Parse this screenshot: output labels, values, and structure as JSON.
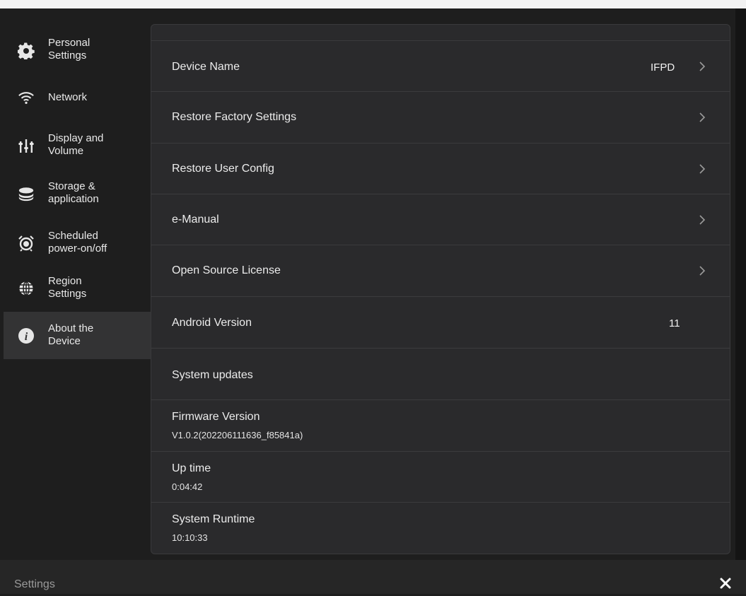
{
  "sidebar": {
    "items": [
      {
        "label": "Personal\nSettings",
        "icon": "gear-icon"
      },
      {
        "label": "Network",
        "icon": "wifi-icon"
      },
      {
        "label": "Display and\nVolume",
        "icon": "sliders-icon"
      },
      {
        "label": "Storage &\napplication",
        "icon": "storage-icon"
      },
      {
        "label": "Scheduled\npower-on/off",
        "icon": "alarm-clock-icon"
      },
      {
        "label": "Region\nSettings",
        "icon": "globe-icon"
      },
      {
        "label": "About the\nDevice",
        "icon": "info-icon",
        "active": true
      }
    ]
  },
  "main": {
    "rows": [
      {
        "label": "Device Name",
        "value": "IFPD",
        "chevron": true
      },
      {
        "label": "Restore Factory Settings",
        "chevron": true
      },
      {
        "label": "Restore User Config",
        "chevron": true
      },
      {
        "label": "e-Manual",
        "chevron": true
      },
      {
        "label": "Open Source License",
        "chevron": true
      },
      {
        "label": "Android Version",
        "value": "11"
      },
      {
        "label": "System updates"
      },
      {
        "label": "Firmware Version",
        "sub": "V1.0.2(202206111636_f85841a)"
      },
      {
        "label": "Up time",
        "sub": "0:04:42"
      },
      {
        "label": "System Runtime",
        "sub": "10:10:33"
      }
    ]
  },
  "footer": {
    "title": "Settings",
    "close_icon": "close-icon"
  },
  "colors": {
    "background": "#1e1e1e",
    "panel": "#2a2a2c",
    "active_item": "#333334"
  }
}
